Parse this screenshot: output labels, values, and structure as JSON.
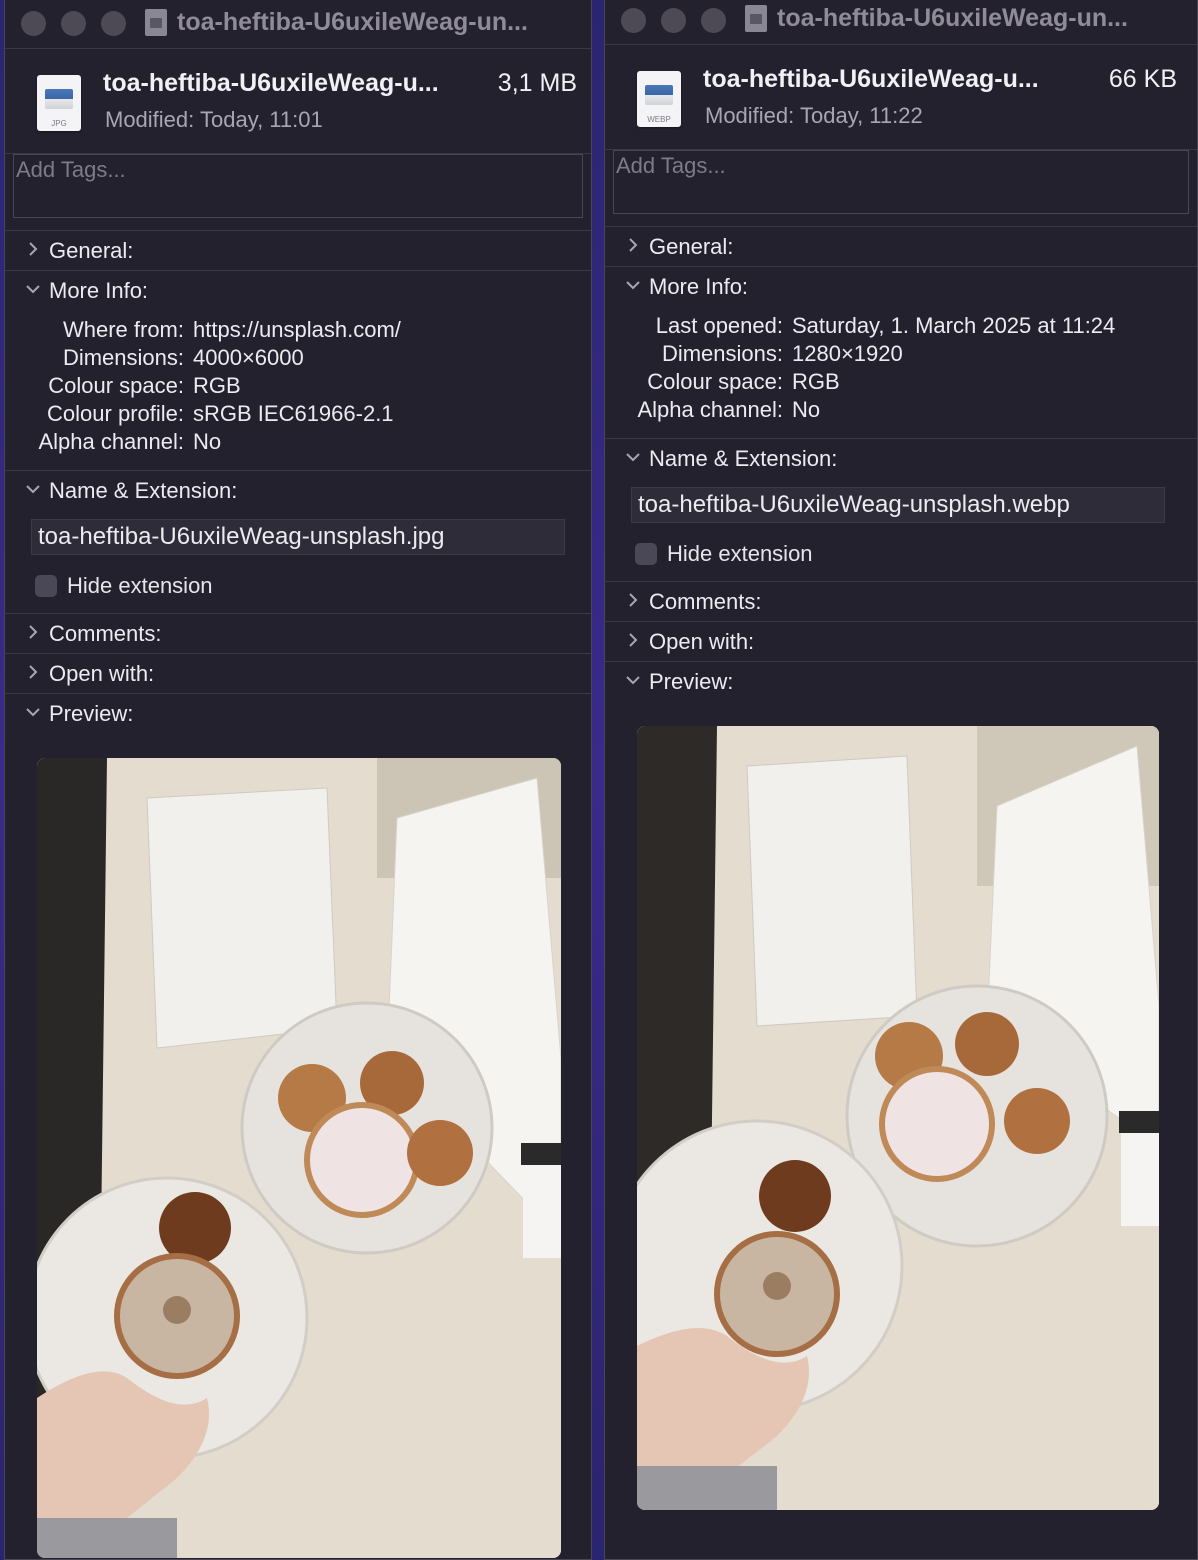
{
  "left": {
    "titlebar_title": "toa-heftiba-U6uxileWeag-un...",
    "file_name": "toa-heftiba-U6uxileWeag-u...",
    "file_size": "3,1 MB",
    "file_type": "JPG",
    "modified_label": "Modified:",
    "modified_value": "Today, 11:01",
    "tags_placeholder": "Add Tags...",
    "general_label": "General:",
    "more_info_label": "More Info:",
    "info_rows": [
      {
        "k": "Where from:",
        "v": "https://unsplash.com/"
      },
      {
        "k": "Dimensions:",
        "v": "4000×6000"
      },
      {
        "k": "Colour space:",
        "v": "RGB"
      },
      {
        "k": "Colour profile:",
        "v": "sRGB IEC61966-2.1"
      },
      {
        "k": "Alpha channel:",
        "v": "No"
      }
    ],
    "name_ext_label": "Name & Extension:",
    "name_value": "toa-heftiba-U6uxileWeag-unsplash.jpg",
    "hide_extension_label": "Hide extension",
    "comments_label": "Comments:",
    "open_with_label": "Open with:",
    "preview_label": "Preview:"
  },
  "right": {
    "titlebar_title": "toa-heftiba-U6uxileWeag-un...",
    "file_name": "toa-heftiba-U6uxileWeag-u...",
    "file_size": "66 KB",
    "file_type": "WEBP",
    "modified_label": "Modified:",
    "modified_value": "Today, 11:22",
    "tags_placeholder": "Add Tags...",
    "general_label": "General:",
    "more_info_label": "More Info:",
    "info_rows": [
      {
        "k": "Last opened:",
        "v": "Saturday, 1. March 2025 at 11:24"
      },
      {
        "k": "Dimensions:",
        "v": "1280×1920"
      },
      {
        "k": "Colour space:",
        "v": "RGB"
      },
      {
        "k": "Alpha channel:",
        "v": "No"
      }
    ],
    "name_ext_label": "Name & Extension:",
    "name_value": "toa-heftiba-U6uxileWeag-unsplash.webp",
    "hide_extension_label": "Hide extension",
    "comments_label": "Comments:",
    "open_with_label": "Open with:",
    "preview_label": "Preview:"
  },
  "icons": [
    "chevron-right-icon",
    "chevron-down-icon",
    "document-icon",
    "file-thumbnail-icon"
  ]
}
